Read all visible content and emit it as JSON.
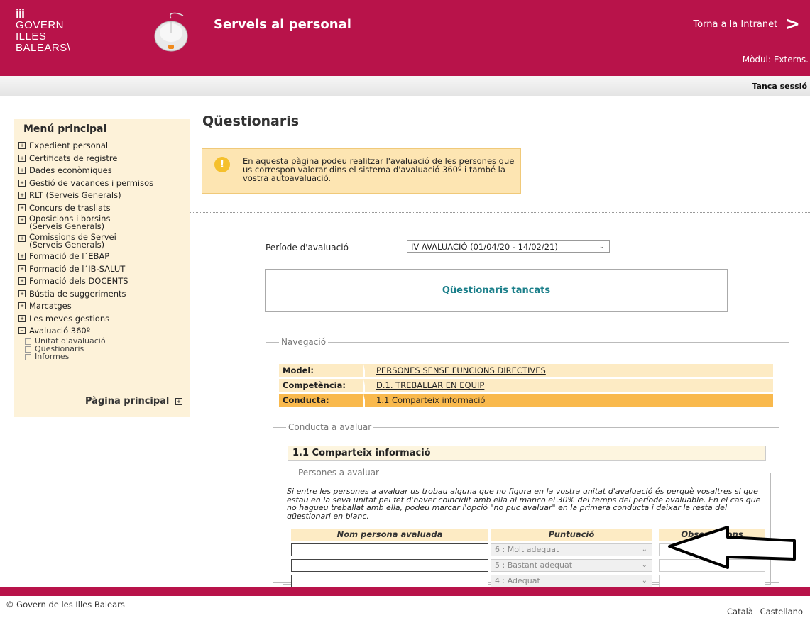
{
  "header": {
    "logo_mark": "iii",
    "logo_lines": [
      "GOVERN",
      "ILLES",
      "BALEARS\\"
    ],
    "app_title": "Serveis al personal",
    "intranet_link": "Torna a la Intranet",
    "modul": "Mòdul: Externs."
  },
  "subbar": {
    "logout": "Tanca sessió"
  },
  "sidebar": {
    "title": "Menú principal",
    "items": [
      {
        "label": "Expedient personal"
      },
      {
        "label": "Certificats de registre"
      },
      {
        "label": "Dades econòmiques"
      },
      {
        "label": "Gestió de vacances i permisos"
      },
      {
        "label": "RLT (Serveis Generals)"
      },
      {
        "label": "Concurs de trasllats"
      },
      {
        "label": "Oposicions i borsins",
        "line2": "(Serveis Generals)"
      },
      {
        "label": "Comissions de Servei",
        "line2": "(Serveis Generals)"
      },
      {
        "label": "Formació de l´EBAP"
      },
      {
        "label": "Formació de l´IB-SALUT"
      },
      {
        "label": "Formació dels DOCENTS"
      },
      {
        "label": "Bústia de suggeriments"
      },
      {
        "label": "Marcatges"
      },
      {
        "label": "Les meves gestions"
      },
      {
        "label": "Avaluació 360º"
      }
    ],
    "subitems": [
      "Unitat d'avaluació",
      "Qüestionaris",
      "Informes"
    ],
    "home": "Pàgina principal"
  },
  "main": {
    "title": "Qüestionaris",
    "info": "En aquesta pàgina podeu realitzar l'avaluació de les persones que us correspon valorar dins el sistema d'avaluació 360º i també la vostra autoavaluació.",
    "period_label": "Període d'avaluació",
    "period_value": "IV AVALUACIÓ (01/04/20 - 14/02/21)",
    "closed": "Qüestionaris tancats",
    "nav": {
      "legend": "Navegació",
      "rows": [
        {
          "label": "Model:",
          "value": "PERSONES SENSE FUNCIONS DIRECTIVES"
        },
        {
          "label": "Competència:",
          "value": "D.1. TREBALLAR EN EQUIP"
        },
        {
          "label": "Conducta:",
          "value": "1.1 Comparteix informació"
        }
      ]
    },
    "conduct": {
      "legend": "Conducta a avaluar",
      "title": "1.1 Comparteix informació"
    },
    "persons": {
      "legend": "Persones a avaluar",
      "note": "Si entre les persones a avaluar us trobau alguna que no figura en la vostra unitat d'avaluació és perquè vosaltres si que estau en la seva unitat pel fet d'haver coincidit amb ella al manco el 30% del temps del període avaluable. En el cas que no hagueu treballat amb ella, podeu marcar l'opció \"no puc avaluar\" en la primera conducta i deixar la resta del qüestionari en blanc.",
      "headers": [
        "Nom persona avaluada",
        "Puntuació",
        "Observacions"
      ],
      "rows": [
        {
          "name": "",
          "score": "6 : Molt adequat",
          "obs": ""
        },
        {
          "name": "",
          "score": "5 : Bastant adequat",
          "obs": ""
        },
        {
          "name": "",
          "score": "4 : Adequat",
          "obs": ""
        }
      ]
    }
  },
  "footer": {
    "copyright": "© Govern de les Illes Balears",
    "languages": [
      "Català",
      "Castellano"
    ]
  }
}
